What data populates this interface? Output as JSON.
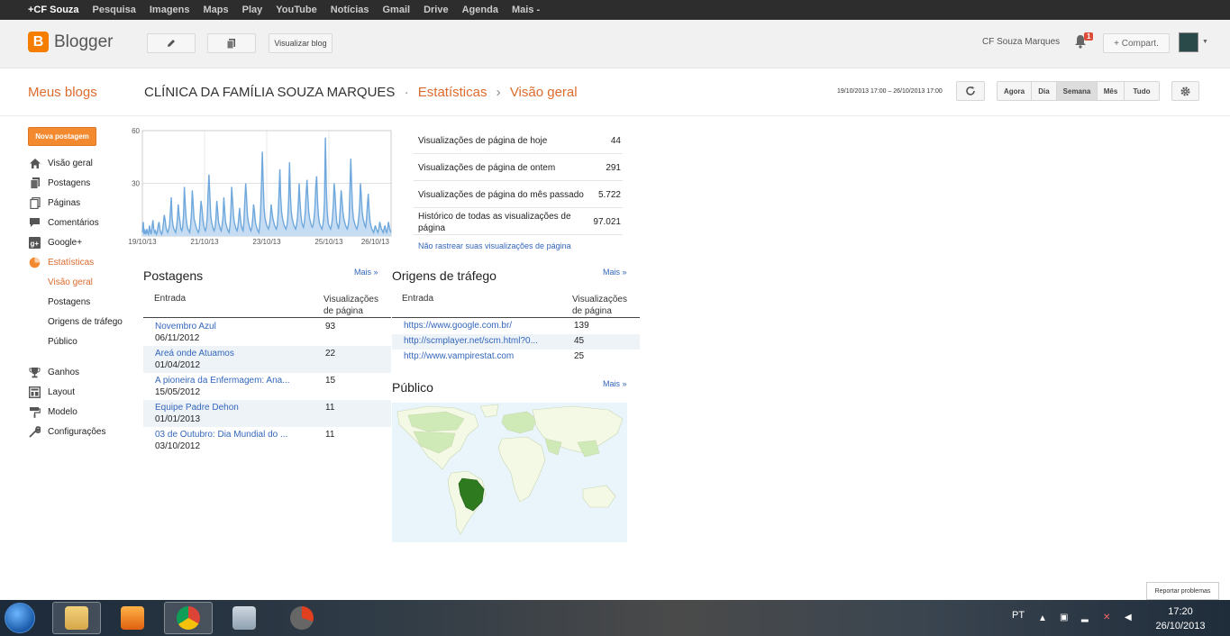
{
  "gbar": {
    "items": [
      "+CF Souza",
      "Pesquisa",
      "Imagens",
      "Maps",
      "Play",
      "YouTube",
      "Notícias",
      "Gmail",
      "Drive",
      "Agenda",
      "Mais -"
    ]
  },
  "header": {
    "brand": "Blogger",
    "view_blog": "Visualizar blog",
    "user": "CF Souza Marques",
    "notif_count": "1",
    "share": "+ Compart."
  },
  "titlebar": {
    "my_blogs": "Meus blogs",
    "blog_name": "CLÍNICA DA FAMÍLIA SOUZA MARQUES",
    "dot": "·",
    "section": "Estatísticas",
    "arrow": "›",
    "page": "Visão geral",
    "date_range": "19/10/2013 17:00 – 26/10/2013 17:00",
    "periods": [
      "Agora",
      "Dia",
      "Semana",
      "Mês",
      "Tudo"
    ],
    "selected_period": "Semana"
  },
  "sidebar": {
    "new_post": "Nova postagem",
    "items": [
      {
        "label": "Visão geral",
        "icon": "home-icon"
      },
      {
        "label": "Postagens",
        "icon": "posts-icon"
      },
      {
        "label": "Páginas",
        "icon": "pages-icon"
      },
      {
        "label": "Comentários",
        "icon": "comment-icon"
      },
      {
        "label": "Google+",
        "icon": "google-plus-icon"
      },
      {
        "label": "Estatísticas",
        "icon": "pie-chart-icon"
      },
      {
        "label": "Ganhos",
        "icon": "trophy-icon"
      },
      {
        "label": "Layout",
        "icon": "layout-icon"
      },
      {
        "label": "Modelo",
        "icon": "paint-roller-icon"
      },
      {
        "label": "Configurações",
        "icon": "wrench-icon"
      }
    ],
    "subitems": [
      "Visão geral",
      "Postagens",
      "Origens de tráfego",
      "Público"
    ]
  },
  "chart_data": {
    "type": "area",
    "y_ticks": [
      "60",
      "30"
    ],
    "ylim": [
      0,
      60
    ],
    "x_labels": [
      "19/10/13",
      "21/10/13",
      "23/10/13",
      "25/10/13",
      "26/10/13"
    ],
    "color": "#6fa8dc",
    "values": [
      2,
      8,
      1,
      3,
      1,
      4,
      2,
      1,
      6,
      3,
      1,
      5,
      9,
      4,
      2,
      3,
      1,
      2,
      6,
      8,
      4,
      2,
      1,
      3,
      7,
      12,
      9,
      5,
      3,
      2,
      4,
      6,
      14,
      22,
      10,
      6,
      4,
      3,
      2,
      5,
      10,
      18,
      12,
      8,
      4,
      3,
      5,
      12,
      28,
      18,
      10,
      6,
      4,
      3,
      2,
      6,
      12,
      26,
      18,
      10,
      8,
      6,
      4,
      3,
      2,
      4,
      12,
      20,
      16,
      10,
      6,
      4,
      3,
      5,
      10,
      24,
      35,
      24,
      12,
      8,
      6,
      4,
      3,
      5,
      10,
      20,
      14,
      8,
      6,
      4,
      3,
      6,
      10,
      22,
      14,
      8,
      6,
      4,
      3,
      2,
      6,
      14,
      28,
      20,
      12,
      8,
      6,
      4,
      3,
      5,
      10,
      16,
      10,
      6,
      4,
      3,
      8,
      20,
      30,
      22,
      12,
      8,
      6,
      4,
      3,
      5,
      10,
      18,
      14,
      8,
      6,
      4,
      3,
      2,
      6,
      14,
      30,
      48,
      30,
      16,
      10,
      8,
      6,
      5,
      4,
      6,
      10,
      18,
      14,
      10,
      8,
      6,
      5,
      4,
      6,
      12,
      24,
      38,
      22,
      14,
      10,
      8,
      6,
      5,
      4,
      6,
      10,
      20,
      42,
      24,
      14,
      10,
      8,
      6,
      5,
      4,
      6,
      10,
      18,
      30,
      20,
      12,
      8,
      6,
      5,
      8,
      14,
      24,
      32,
      22,
      14,
      10,
      8,
      6,
      5,
      6,
      10,
      16,
      28,
      34,
      20,
      12,
      8,
      6,
      5,
      4,
      6,
      10,
      20,
      56,
      28,
      14,
      8,
      6,
      5,
      4,
      6,
      10,
      18,
      30,
      24,
      14,
      8,
      6,
      4,
      8,
      16,
      26,
      20,
      14,
      10,
      8,
      6,
      5,
      4,
      6,
      10,
      26,
      44,
      28,
      16,
      10,
      8,
      6,
      5,
      4,
      6,
      10,
      16,
      30,
      22,
      14,
      10,
      8,
      6,
      5,
      10,
      18,
      24,
      14,
      8,
      6,
      4,
      3,
      2,
      4,
      6,
      4,
      3,
      2,
      4,
      8,
      6,
      4,
      3,
      2,
      4,
      6,
      3,
      2,
      4,
      8,
      5,
      3,
      2
    ]
  },
  "stats": {
    "rows": [
      {
        "label": "Visualizações de página de hoje",
        "value": "44"
      },
      {
        "label": "Visualizações de página de ontem",
        "value": "291"
      },
      {
        "label": "Visualizações de página do mês passado",
        "value": "5.722"
      },
      {
        "label": "Histórico de todas as visualizações de página",
        "value": "97.021"
      }
    ],
    "no_track": "Não rastrear suas visualizações de página"
  },
  "posts": {
    "title": "Postagens",
    "more": "Mais »",
    "col_entry": "Entrada",
    "col_views": "Visualizações de página",
    "rows": [
      {
        "title": "Novembro Azul",
        "date": "06/11/2012",
        "views": "93"
      },
      {
        "title": "Areá onde Atuamos",
        "date": "01/04/2012",
        "views": "22"
      },
      {
        "title": "A pioneira da Enfermagem: Ana...",
        "date": "15/05/2012",
        "views": "15"
      },
      {
        "title": "Equipe Padre Dehon",
        "date": "01/01/2013",
        "views": "11"
      },
      {
        "title": "03 de Outubro: Dia Mundial do ...",
        "date": "03/10/2012",
        "views": "11"
      }
    ]
  },
  "traffic": {
    "title": "Origens de tráfego",
    "more": "Mais »",
    "col_entry": "Entrada",
    "col_views": "Visualizações de página",
    "rows": [
      {
        "url": "https://www.google.com.br/",
        "views": "139"
      },
      {
        "url": "http://scmplayer.net/scm.html?0...",
        "views": "45"
      },
      {
        "url": "http://www.vampirestat.com",
        "views": "25"
      }
    ]
  },
  "audience": {
    "title": "Público",
    "more": "Mais »"
  },
  "taskbar": {
    "report": "Reportar problemas",
    "lang": "PT",
    "time": "17:20",
    "date": "26/10/2013"
  }
}
